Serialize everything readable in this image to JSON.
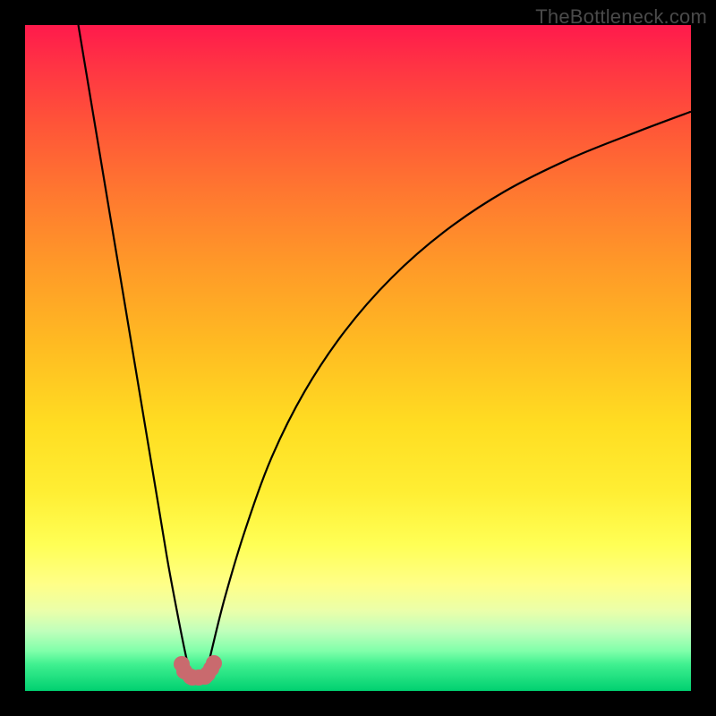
{
  "watermark": "TheBottleneck.com",
  "chart_data": {
    "type": "line",
    "title": "",
    "xlabel": "",
    "ylabel": "",
    "xlim": [
      0,
      100
    ],
    "ylim": [
      0,
      100
    ],
    "series": [
      {
        "name": "left-branch",
        "x": [
          8,
          10,
          12,
          14,
          16,
          18,
          20,
          21.5,
          23,
          24,
          24.8
        ],
        "values": [
          100,
          88,
          76,
          64,
          52,
          40,
          28,
          19,
          11,
          6,
          2.5
        ]
      },
      {
        "name": "right-branch",
        "x": [
          27.2,
          28,
          30,
          33,
          37,
          42,
          48,
          55,
          63,
          72,
          82,
          92,
          100
        ],
        "values": [
          2.5,
          6,
          14,
          24,
          35,
          45,
          54,
          62,
          69,
          75,
          80,
          84,
          87
        ]
      }
    ],
    "markers": {
      "name": "valley-beads",
      "x": [
        23.5,
        23.9,
        24.8,
        25.2,
        26.1,
        27.0,
        27.4,
        27.9,
        28.4
      ],
      "values": [
        4.0,
        3.0,
        2.2,
        2.0,
        2.0,
        2.2,
        2.6,
        3.4,
        4.2
      ],
      "color": "#c96a6e"
    }
  }
}
